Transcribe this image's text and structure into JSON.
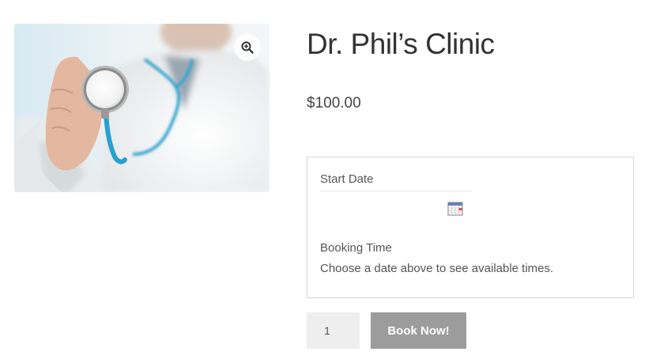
{
  "product": {
    "title": "Dr. Phil’s Clinic",
    "price": "$100.00",
    "image": {
      "subject": "doctor-holding-stethoscope"
    }
  },
  "booking_form": {
    "start_date_label": "Start Date",
    "start_date_value": "",
    "booking_time_label": "Booking Time",
    "booking_time_hint": "Choose a date above to see available times."
  },
  "cart": {
    "quantity": "1",
    "book_button_label": "Book Now!"
  },
  "icons": {
    "zoom": "zoom-in-icon",
    "calendar": "calendar-icon"
  },
  "colors": {
    "button_background": "#9c9c9c",
    "quantity_background": "#eeeeee",
    "border": "#d6d6d6"
  }
}
